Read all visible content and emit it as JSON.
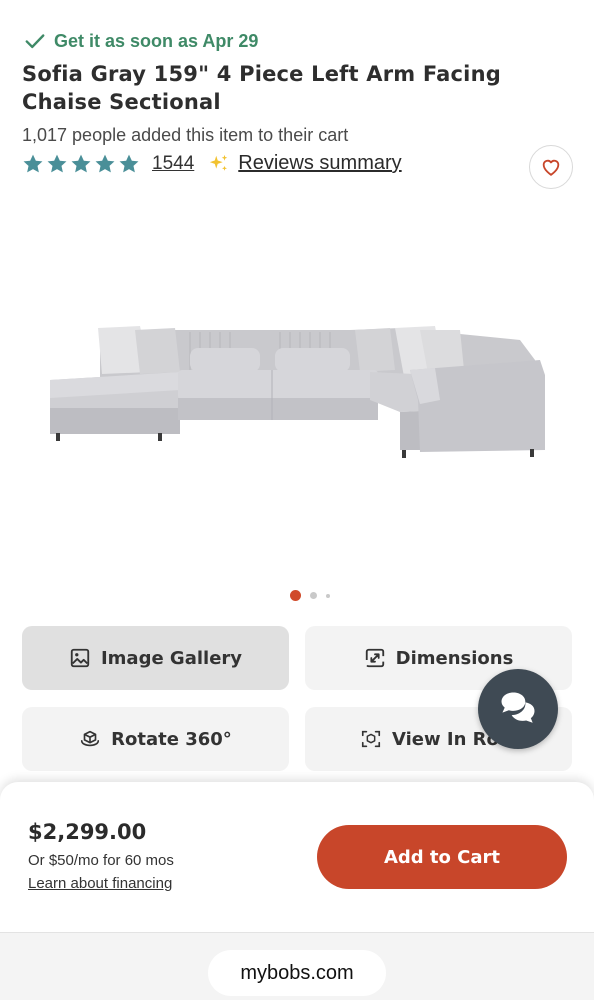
{
  "delivery": {
    "text": "Get it as soon as Apr 29",
    "color": "#3f8a67"
  },
  "product": {
    "title": "Sofia Gray 159\" 4 Piece Left Arm Facing Chaise Sectional",
    "cart_count_text": "1,017 people added this item to their cart",
    "rating_stars": 5,
    "review_count": "1544",
    "reviews_summary_label": "Reviews summary"
  },
  "carousel": {
    "slides": 3,
    "active_index": 0
  },
  "media_buttons": [
    {
      "label": "Image Gallery",
      "icon": "image-icon"
    },
    {
      "label": "Dimensions",
      "icon": "resize-icon"
    },
    {
      "label": "Rotate 360°",
      "icon": "rotate-360-icon"
    },
    {
      "label": "View In Room",
      "icon": "ar-cube-icon"
    }
  ],
  "purchase": {
    "price": "$2,299.00",
    "monthly": "Or $50/mo for 60 mos",
    "financing_link": "Learn about financing",
    "add_to_cart": "Add to Cart"
  },
  "browser": {
    "url": "mybobs.com"
  },
  "colors": {
    "accent": "#c8462a",
    "star": "#4a8f98",
    "chat": "#3f4a54"
  }
}
